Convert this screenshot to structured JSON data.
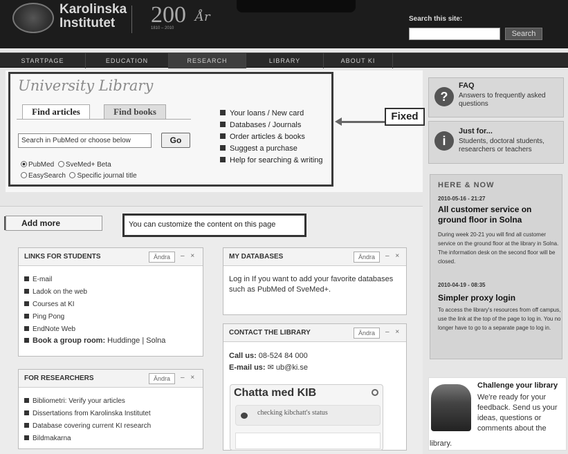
{
  "header": {
    "logo_line1": "Karolinska",
    "logo_line2": "Institutet",
    "anniversary": "200",
    "anniversary_script": "År",
    "anniversary_years": "1810 – 2010",
    "search_label": "Search this site:",
    "search_value": "",
    "search_button": "Search"
  },
  "nav": [
    "STARTPAGE",
    "EDUCATION",
    "RESEARCH",
    "LIBRARY",
    "ABOUT KI"
  ],
  "library": {
    "title": "University Library",
    "tab_articles": "Find articles",
    "tab_books": "Find books",
    "search_placeholder": "Search in PubMed or choose below",
    "go": "Go",
    "radios": [
      "PubMed",
      "SveMed+ Beta",
      "EasySearch",
      "Specific journal title"
    ],
    "quick_links": [
      "Your loans / New card",
      "Databases / Journals",
      "Order articles & books",
      "Suggest a purchase",
      "Help for searching & writing"
    ]
  },
  "annotation_fixed": "Fixed",
  "sidebar": {
    "faq_title": "FAQ",
    "faq_text": "Answers to frequently asked questions",
    "just_title": "Just for...",
    "just_text": "Students, doctoral students, researchers or teachers",
    "here_now_title": "HERE & NOW",
    "news": [
      {
        "date": "2010-05-16 - 21:27",
        "headline": "All customer service on ground floor in Solna",
        "body": "During week 20-21 you will find all customer service on the ground floor at the library in Solna. The information desk on the second floor will be closed."
      },
      {
        "date": "2010-04-19 - 08:35",
        "headline": "Simpler proxy login",
        "body": "To access the library's resources from off campus, use the link at the top of the page to log in. You no longer have to go to a separate page to log in."
      }
    ],
    "challenge_title": "Challenge your library",
    "challenge_text": "We're ready for your feedback. Send us your ideas, questions or comments about the",
    "challenge_tail": "library."
  },
  "main": {
    "add_more": "Add more",
    "customize_note": "You can customize the content on this page",
    "andra": "Ändra",
    "links_students": {
      "title": "LINKS FOR STUDENTS",
      "items": [
        "E-mail",
        "Ladok on the web",
        "Courses at KI",
        "Ping Pong",
        "EndNote Web"
      ],
      "group_room_label": "Book a group room:",
      "group_room_value": "Huddinge | Solna"
    },
    "researchers": {
      "title": "FOR RESEARCHERS",
      "items": [
        "Bibliometri: Verify your articles",
        "Dissertations from Karolinska Institutet",
        "Database covering current KI research",
        "Bildmakarna"
      ]
    },
    "my_databases": {
      "title": "MY DATABASES",
      "text": "Log in If you want to add your favorite databases such as PubMed of SveMed+."
    },
    "contact": {
      "title": "CONTACT THE LIBRARY",
      "call_label": "Call us:",
      "call_value": "08-524 84 000",
      "email_label": "E-mail us:",
      "email_value": "✉ ub@ki.se"
    },
    "chat": {
      "title": "Chatta med KIB",
      "status": "checking kibchatt's status"
    }
  }
}
